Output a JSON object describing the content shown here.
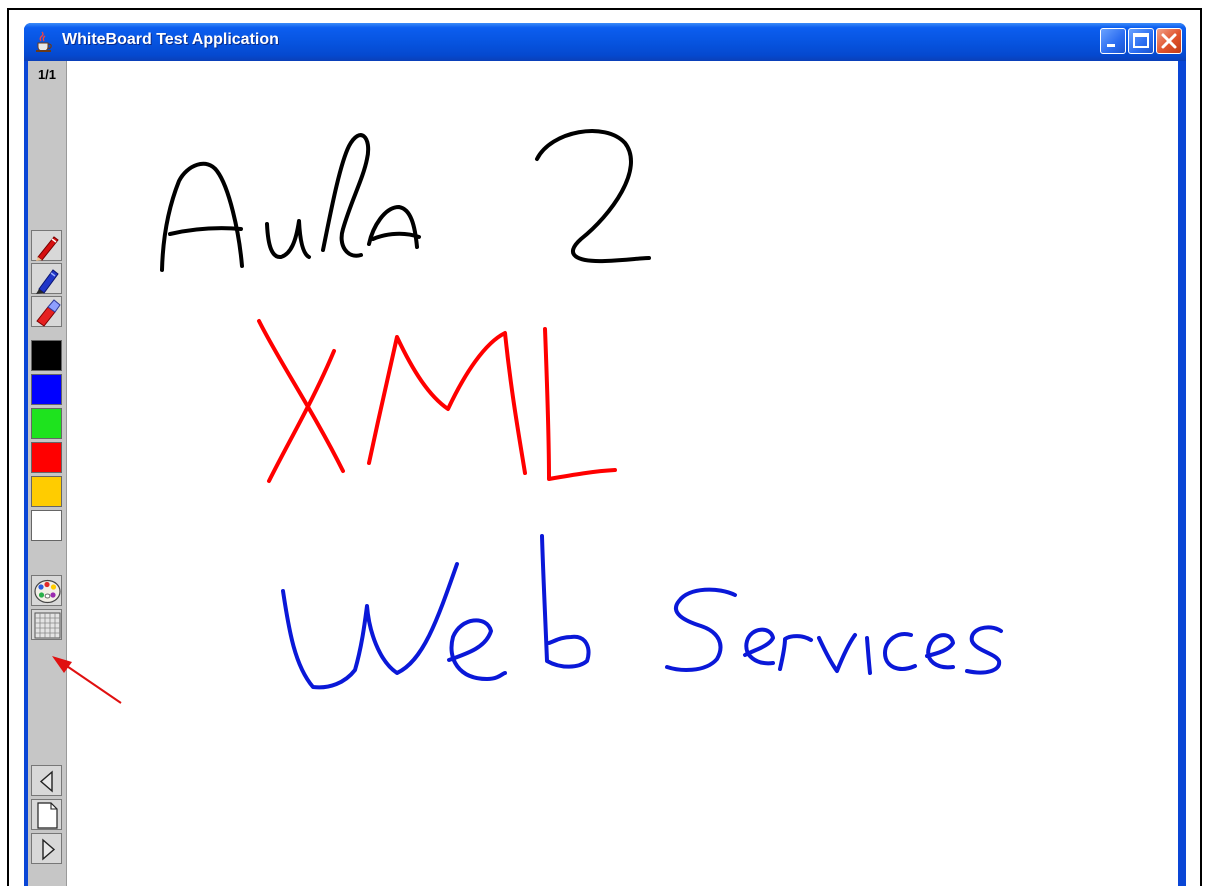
{
  "window": {
    "title": "WhiteBoard Test Application"
  },
  "toolbar": {
    "page_indicator": "1/1",
    "tools": [
      "red-pen",
      "blue-marker",
      "eraser"
    ],
    "colors": [
      "#000000",
      "#0000ff",
      "#1ee31e",
      "#ff0000",
      "#ffcc00",
      "#ffffff"
    ],
    "extra": [
      "palette",
      "grid"
    ],
    "nav": [
      "previous-page",
      "new-page",
      "next-page"
    ]
  },
  "whiteboard": {
    "strokes": [
      {
        "text": "Aula 2",
        "color": "#000000"
      },
      {
        "text": "XML",
        "color": "#ff0000"
      },
      {
        "text": "Web Services",
        "color": "#0a18d8"
      }
    ]
  },
  "annotation": {
    "arrow_color": "#e01010"
  }
}
